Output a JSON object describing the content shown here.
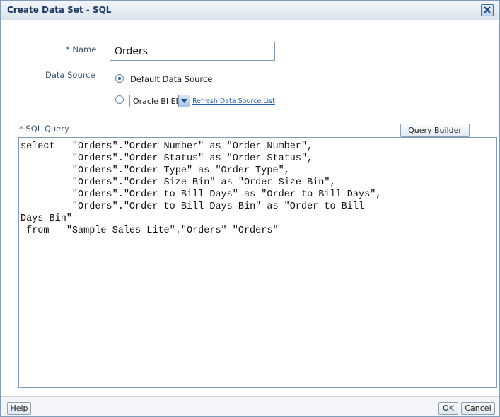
{
  "dialog": {
    "title": "Create Data Set - SQL",
    "close_icon": "close-icon"
  },
  "form": {
    "name_required_marker": "*",
    "name_label": "Name",
    "name_value": "Orders",
    "data_source_label": "Data Source",
    "default_source_label": "Default Data Source",
    "default_source_selected": true,
    "other_source_selected": false,
    "other_source_value": "Oracle BI EE",
    "refresh_link": "Refresh Data Source List",
    "sql_label": "* SQL Query",
    "query_builder_button": "Query Builder",
    "sql_text": "select   \"Orders\".\"Order Number\" as \"Order Number\",\n         \"Orders\".\"Order Status\" as \"Order Status\",\n         \"Orders\".\"Order Type\" as \"Order Type\",\n         \"Orders\".\"Order Size Bin\" as \"Order Size Bin\",\n         \"Orders\".\"Order to Bill Days\" as \"Order to Bill Days\",\n         \"Orders\".\"Order to Bill Days Bin\" as \"Order to Bill\nDays Bin\"\n from   \"Sample Sales Lite\".\"Orders\" \"Orders\""
  },
  "footer": {
    "help_button": "Help",
    "ok_button": "OK",
    "cancel_button": "Cancel"
  }
}
